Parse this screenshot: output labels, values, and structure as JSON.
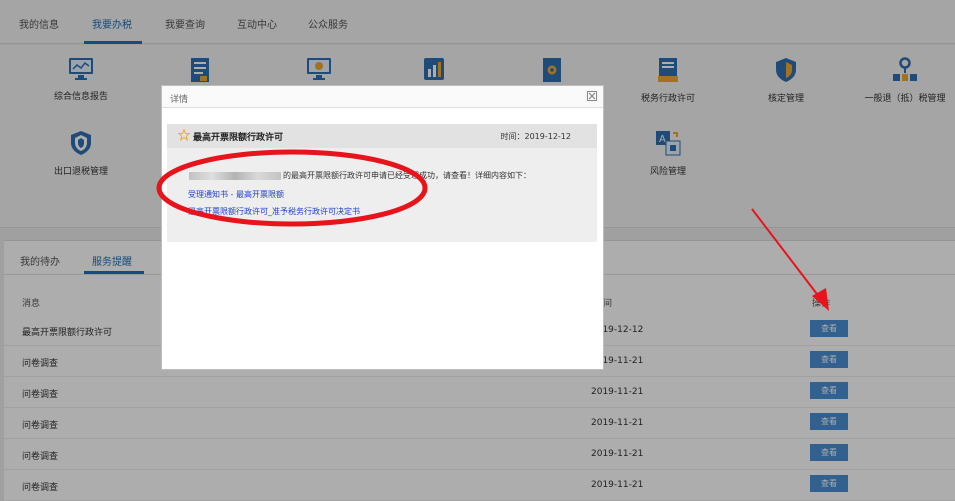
{
  "nav": {
    "tabs": [
      {
        "label": "我的信息"
      },
      {
        "label": "我要办税"
      },
      {
        "label": "我要查询"
      },
      {
        "label": "互动中心"
      },
      {
        "label": "公众服务"
      }
    ],
    "active_index": 1
  },
  "functions": [
    {
      "label": "综合信息报告",
      "icon": "monitor-chart-icon"
    },
    {
      "label": "",
      "icon": "document-icon"
    },
    {
      "label": "",
      "icon": "monitor-gear-icon"
    },
    {
      "label": "",
      "icon": "bar-chart-icon"
    },
    {
      "label": "",
      "icon": "file-gear-icon"
    },
    {
      "label": "税务行政许可",
      "icon": "certificate-icon"
    },
    {
      "label": "核定管理",
      "icon": "shield-icon"
    },
    {
      "label": "一般退（抵）税管理",
      "icon": "org-chart-icon"
    },
    {
      "label": "出口退税管理",
      "icon": "security-shield-icon"
    },
    {
      "label": "风险管理",
      "icon": "translate-icon"
    }
  ],
  "bottom": {
    "tabs": [
      {
        "label": "我的待办"
      },
      {
        "label": "服务提醒"
      }
    ],
    "active_index": 1,
    "headers": {
      "message": "消息",
      "time": "时间",
      "action": "操作"
    },
    "rows": [
      {
        "message": "最高开票限额行政许可",
        "time": "2019-12-12",
        "action": "查看"
      },
      {
        "message": "问卷调查",
        "time": "2019-11-21",
        "action": "查看"
      },
      {
        "message": "问卷调查",
        "time": "2019-11-21",
        "action": "查看"
      },
      {
        "message": "问卷调查",
        "time": "2019-11-21",
        "action": "查看"
      },
      {
        "message": "问卷调查",
        "time": "2019-11-21",
        "action": "查看"
      },
      {
        "message": "问卷调查",
        "time": "2019-11-21",
        "action": "查看"
      }
    ]
  },
  "modal": {
    "header_title": "详情",
    "item_title": "最高开票限额行政许可",
    "time_text": "时间：2019-12-12",
    "message_text": "的最高开票限额行政许可申请已经受理成功，请查看！详细内容如下：",
    "links": [
      "受理通知书 - 最高开票限额",
      "最高开票限额行政许可_准予税务行政许可决定书"
    ]
  },
  "colors": {
    "accent": "#1f6fb8",
    "button": "#4a8fd3",
    "annotation": "#e8141c",
    "link": "#1f3fc8"
  }
}
